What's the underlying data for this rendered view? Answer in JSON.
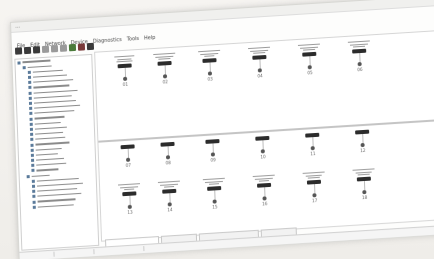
{
  "window": {
    "title": "…"
  },
  "menu": [
    "File",
    "Edit",
    "Network",
    "Device",
    "Diagnostics",
    "Tools",
    "Help"
  ],
  "toolbar": {
    "buttons": [
      {
        "icon": "new-icon",
        "tone": "d"
      },
      {
        "icon": "open-icon",
        "tone": "d"
      },
      {
        "icon": "save-icon",
        "tone": "d"
      },
      {
        "icon": "cut-icon",
        "tone": "l"
      },
      {
        "icon": "copy-icon",
        "tone": "l"
      },
      {
        "icon": "paste-icon",
        "tone": "l"
      },
      {
        "icon": "connect-icon",
        "tone": "g"
      },
      {
        "icon": "disconnect-icon",
        "tone": "r"
      },
      {
        "icon": "refresh-icon",
        "tone": "d"
      }
    ]
  },
  "tree": {
    "rows": [
      {
        "indent": 0,
        "w": 28
      },
      {
        "indent": 1,
        "w": 24
      },
      {
        "indent": 2,
        "w": 30
      },
      {
        "indent": 2,
        "w": 34
      },
      {
        "indent": 2,
        "w": 40
      },
      {
        "indent": 2,
        "w": 36
      },
      {
        "indent": 2,
        "w": 44
      },
      {
        "indent": 2,
        "w": 38
      },
      {
        "indent": 2,
        "w": 42
      },
      {
        "indent": 2,
        "w": 46
      },
      {
        "indent": 2,
        "w": 40
      },
      {
        "indent": 2,
        "w": 30
      },
      {
        "indent": 2,
        "w": 26
      },
      {
        "indent": 2,
        "w": 32
      },
      {
        "indent": 2,
        "w": 28
      },
      {
        "indent": 2,
        "w": 30
      },
      {
        "indent": 2,
        "w": 34
      },
      {
        "indent": 2,
        "w": 26
      },
      {
        "indent": 2,
        "w": 22
      },
      {
        "indent": 2,
        "w": 28
      },
      {
        "indent": 2,
        "w": 30
      },
      {
        "indent": 2,
        "w": 22
      },
      {
        "indent": 1,
        "w": 18
      },
      {
        "indent": 2,
        "w": 42
      },
      {
        "indent": 2,
        "w": 46
      },
      {
        "indent": 2,
        "w": 40
      },
      {
        "indent": 2,
        "w": 44
      },
      {
        "indent": 2,
        "w": 38
      },
      {
        "indent": 2,
        "w": 36
      }
    ]
  },
  "diagram": {
    "top_row": [
      {
        "num": "01",
        "lines": [
          20,
          14,
          16
        ]
      },
      {
        "num": "02",
        "lines": [
          22,
          18,
          12
        ]
      },
      {
        "num": "03",
        "lines": [
          22,
          18,
          10
        ]
      },
      {
        "num": "04",
        "lines": [
          22,
          18,
          12
        ]
      },
      {
        "num": "05",
        "lines": [
          22,
          18,
          12
        ]
      },
      {
        "num": "06",
        "lines": [
          22,
          18,
          12
        ]
      }
    ],
    "middle_row": [
      {
        "num": "07"
      },
      {
        "num": "08"
      },
      {
        "num": "09"
      },
      {
        "num": "10"
      },
      {
        "num": "11"
      },
      {
        "num": "12"
      }
    ],
    "bottom_row": [
      {
        "num": "13",
        "lines": [
          22,
          18,
          10
        ]
      },
      {
        "num": "14",
        "lines": [
          22,
          18,
          10
        ]
      },
      {
        "num": "15",
        "lines": [
          22,
          18,
          10
        ]
      },
      {
        "num": "16",
        "lines": [
          22,
          18,
          10
        ]
      },
      {
        "num": "17",
        "lines": [
          22,
          16,
          12
        ]
      },
      {
        "num": "18",
        "lines": [
          22,
          16,
          12
        ]
      }
    ]
  },
  "tabs": [
    {
      "w": 52
    },
    {
      "w": 34
    },
    {
      "w": 58
    },
    {
      "w": 34
    }
  ],
  "status": {
    "fields": [
      {
        "w": 30
      },
      {
        "w": 20
      },
      {
        "w": 30
      }
    ]
  }
}
